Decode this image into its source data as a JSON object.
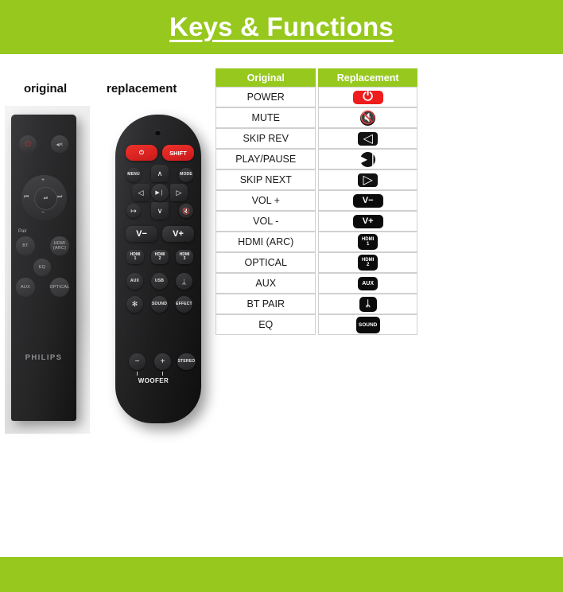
{
  "header": {
    "title": "Keys & Functions"
  },
  "captions": {
    "original": "original",
    "replacement": "replacement"
  },
  "colors": {
    "green": "#96c81e",
    "red": "#ee1c1c",
    "black": "#0b0b0b",
    "white": "#ffffff"
  },
  "table": {
    "headers": {
      "original": "Original",
      "replacement": "Replacement"
    },
    "rows": [
      {
        "fn": "POWER",
        "icon": "power-icon",
        "icon_label": "⏻",
        "style": "pwr"
      },
      {
        "fn": "MUTE",
        "icon": "mute-icon",
        "icon_label": "🔇",
        "style": "circ"
      },
      {
        "fn": "SKIP REV",
        "icon": "skip-rev-icon",
        "icon_label": "◁",
        "style": "tri"
      },
      {
        "fn": "PLAY/PAUSE",
        "icon": "play-pause-icon",
        "icon_label": "▶❘",
        "style": "circ"
      },
      {
        "fn": "SKIP NEXT",
        "icon": "skip-next-icon",
        "icon_label": "▷",
        "style": "tri"
      },
      {
        "fn": "VOL +",
        "icon": "volume-down-icon",
        "icon_label": "V−",
        "style": "vol"
      },
      {
        "fn": "VOL -",
        "icon": "volume-up-icon",
        "icon_label": "V+",
        "style": "vol"
      },
      {
        "fn": "HDMI (ARC)",
        "icon": "hdmi-1-icon",
        "icon_label": "HDMI\n1",
        "style": "sq"
      },
      {
        "fn": "OPTICAL",
        "icon": "hdmi-2-icon",
        "icon_label": "HDMI\n2",
        "style": "sq"
      },
      {
        "fn": "AUX",
        "icon": "aux-icon",
        "icon_label": "AUX",
        "style": "aux"
      },
      {
        "fn": "BT PAIR",
        "icon": "bluetooth-icon",
        "icon_label": "ᛦ",
        "style": "bt"
      },
      {
        "fn": "EQ",
        "icon": "sound-icon",
        "icon_label": "SOUND",
        "style": "snd"
      }
    ]
  },
  "original_remote": {
    "brand": "PHILIPS",
    "pair_label": "Pair",
    "buttons": [
      {
        "name": "power",
        "label": "⏻"
      },
      {
        "name": "mute",
        "label": "◂×"
      },
      {
        "name": "vol-up",
        "label": "+"
      },
      {
        "name": "vol-down",
        "label": "−"
      },
      {
        "name": "skip-rev",
        "label": "⏮"
      },
      {
        "name": "play-pause",
        "label": "⏯"
      },
      {
        "name": "skip-next",
        "label": "⏭"
      },
      {
        "name": "bt",
        "label": "BT"
      },
      {
        "name": "hdmi-arc",
        "label": "HDMI\n(ARC)"
      },
      {
        "name": "eq",
        "label": "EQ"
      },
      {
        "name": "aux",
        "label": "AUX"
      },
      {
        "name": "optical",
        "label": "OPTICAL"
      }
    ]
  },
  "replacement_remote": {
    "woofer_label": "WOOFER",
    "buttons": [
      {
        "name": "power",
        "label": "⏻"
      },
      {
        "name": "shift",
        "label": "SHIFT"
      },
      {
        "name": "menu",
        "label": "MENU"
      },
      {
        "name": "mode",
        "label": "MODE"
      },
      {
        "name": "up",
        "label": "∧"
      },
      {
        "name": "down",
        "label": "∨"
      },
      {
        "name": "skip-rev",
        "label": "◁"
      },
      {
        "name": "skip-next",
        "label": "▷"
      },
      {
        "name": "play-pause",
        "label": "▶❘"
      },
      {
        "name": "input",
        "label": "↦"
      },
      {
        "name": "mute",
        "label": "🔇"
      },
      {
        "name": "vol-down",
        "label": "V−"
      },
      {
        "name": "vol-up",
        "label": "V+"
      },
      {
        "name": "hdmi-1",
        "label": "HDMI\n1"
      },
      {
        "name": "hdmi-2",
        "label": "HDMI\n2"
      },
      {
        "name": "hdmi-3",
        "label": "HDMI\n3"
      },
      {
        "name": "aux",
        "label": "AUX"
      },
      {
        "name": "usb",
        "label": "USB"
      },
      {
        "name": "bluetooth",
        "label": "ᛦ"
      },
      {
        "name": "light",
        "label": "✻"
      },
      {
        "name": "sound",
        "label": "SOUND"
      },
      {
        "name": "effect",
        "label": "EFFECT"
      },
      {
        "name": "woofer-down",
        "label": "−"
      },
      {
        "name": "woofer-up",
        "label": "+"
      },
      {
        "name": "stereo",
        "label": "STEREO"
      }
    ]
  }
}
